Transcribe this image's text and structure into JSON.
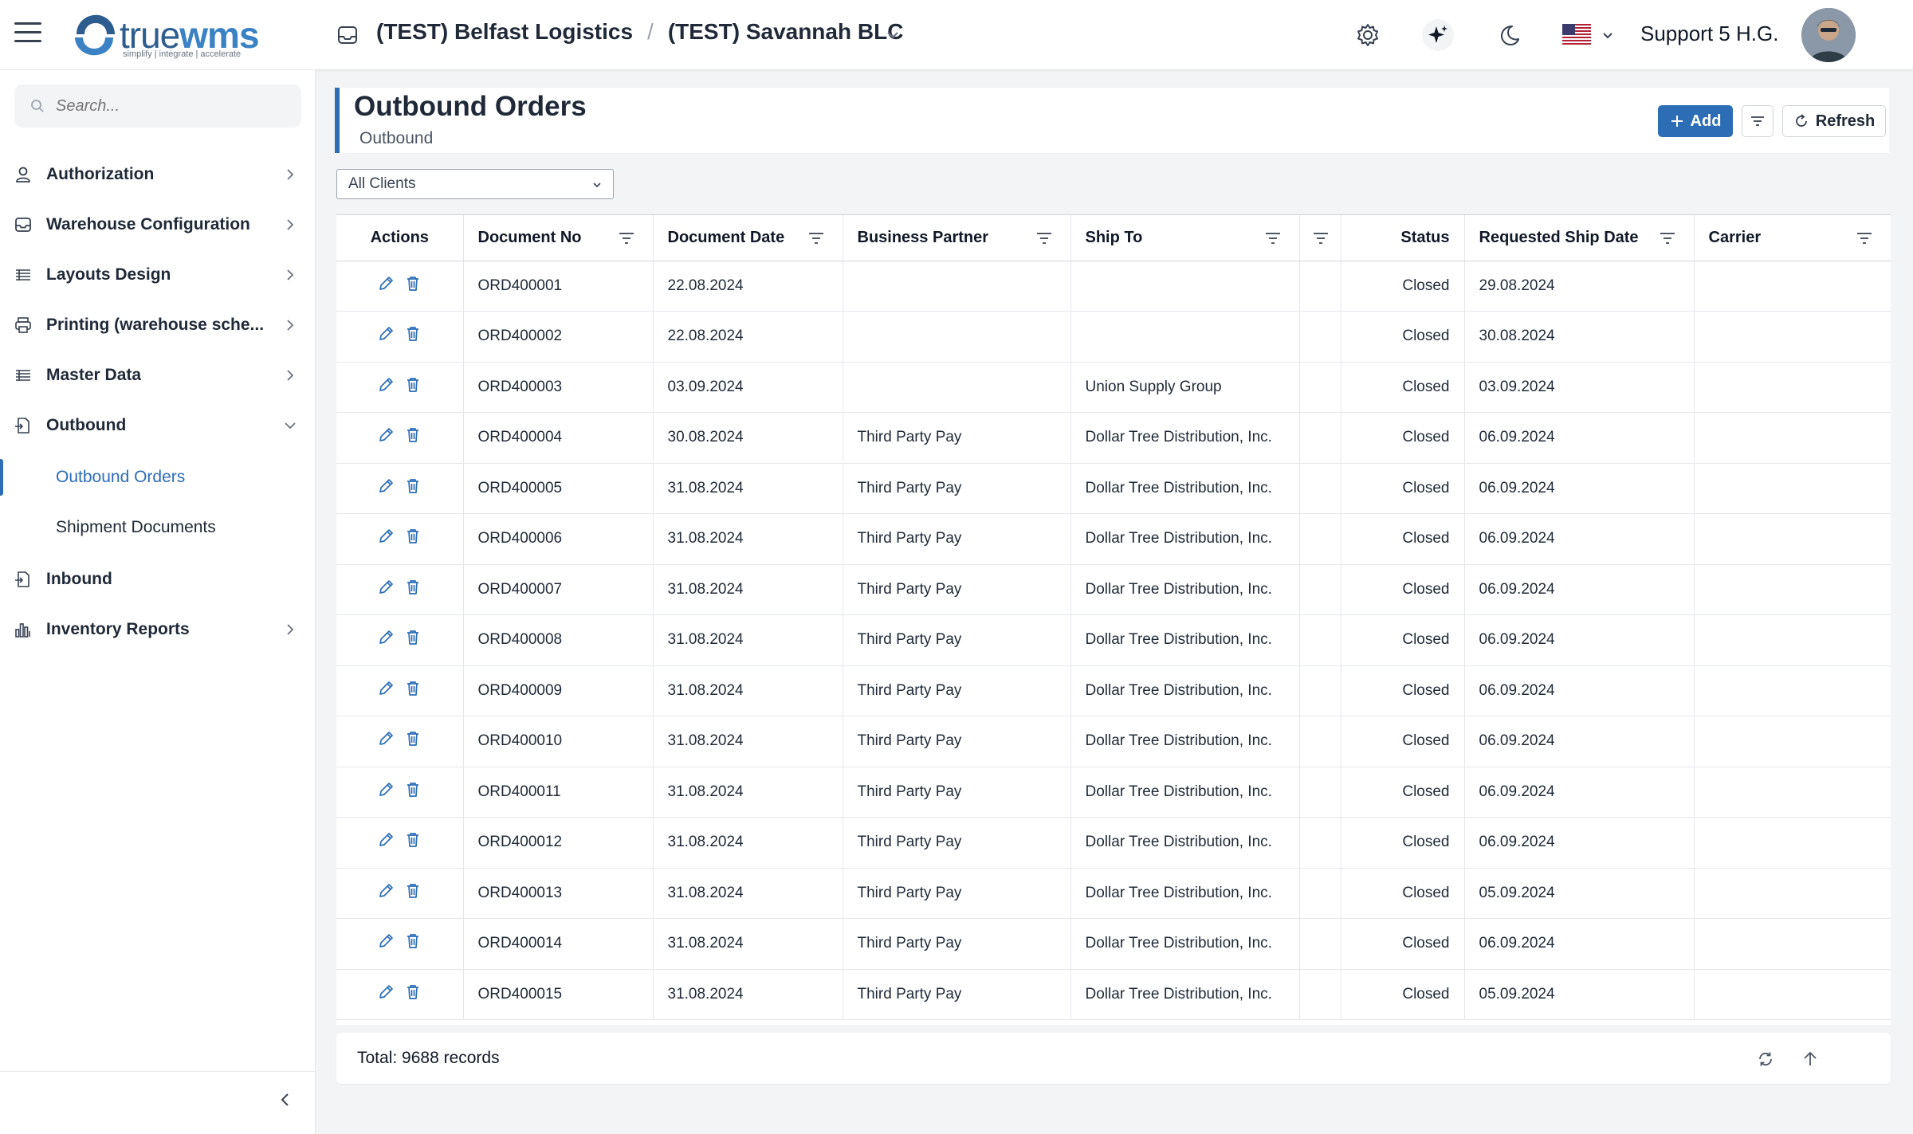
{
  "header": {
    "logo_text_regular": "true",
    "logo_text_bold": "wms",
    "logo_tagline": "simplify | integrate | accelerate",
    "company": "(TEST) Belfast Logistics",
    "separator": "/",
    "warehouse": "(TEST) Savannah BLC",
    "username": "Support 5 H.G.",
    "icons": [
      "menu-icon",
      "warehouse-icon",
      "chevron-down-icon",
      "gear-icon",
      "sparkle-icon",
      "moon-icon",
      "us-flag-icon",
      "user-avatar"
    ]
  },
  "sidebar": {
    "search_placeholder": "Search...",
    "items": [
      {
        "label": "Authorization",
        "icon": "user-icon"
      },
      {
        "label": "Warehouse Configuration",
        "icon": "inbox-icon"
      },
      {
        "label": "Layouts Design",
        "icon": "grid-list-icon"
      },
      {
        "label": "Printing (warehouse sche...",
        "icon": "printer-icon"
      },
      {
        "label": "Master Data",
        "icon": "grid-list-icon"
      },
      {
        "label": "Outbound",
        "icon": "document-out-icon",
        "expanded": true
      },
      {
        "label": "Inbound",
        "icon": "document-in-icon"
      },
      {
        "label": "Inventory Reports",
        "icon": "bar-chart-icon"
      }
    ],
    "subitems": [
      {
        "label": "Outbound Orders",
        "active": true
      },
      {
        "label": "Shipment Documents",
        "active": false
      }
    ]
  },
  "page": {
    "title": "Outbound Orders",
    "subtitle": "Outbound",
    "add_label": "Add",
    "refresh_label": "Refresh",
    "client_filter": "All Clients"
  },
  "table": {
    "columns": [
      "Actions",
      "Document No",
      "Document Date",
      "Business Partner",
      "Ship To",
      "",
      "Status",
      "Requested Ship Date",
      "Carrier"
    ],
    "rows": [
      {
        "doc": "ORD400001",
        "date": "22.08.2024",
        "partner": "",
        "ship_to": "",
        "status": "Closed",
        "req": "29.08.2024",
        "carrier": ""
      },
      {
        "doc": "ORD400002",
        "date": "22.08.2024",
        "partner": "",
        "ship_to": "",
        "status": "Closed",
        "req": "30.08.2024",
        "carrier": ""
      },
      {
        "doc": "ORD400003",
        "date": "03.09.2024",
        "partner": "",
        "ship_to": "Union Supply Group",
        "status": "Closed",
        "req": "03.09.2024",
        "carrier": ""
      },
      {
        "doc": "ORD400004",
        "date": "30.08.2024",
        "partner": "Third Party Pay",
        "ship_to": "Dollar Tree Distribution, Inc.",
        "status": "Closed",
        "req": "06.09.2024",
        "carrier": ""
      },
      {
        "doc": "ORD400005",
        "date": "31.08.2024",
        "partner": "Third Party Pay",
        "ship_to": "Dollar Tree Distribution, Inc.",
        "status": "Closed",
        "req": "06.09.2024",
        "carrier": ""
      },
      {
        "doc": "ORD400006",
        "date": "31.08.2024",
        "partner": "Third Party Pay",
        "ship_to": "Dollar Tree Distribution, Inc.",
        "status": "Closed",
        "req": "06.09.2024",
        "carrier": ""
      },
      {
        "doc": "ORD400007",
        "date": "31.08.2024",
        "partner": "Third Party Pay",
        "ship_to": "Dollar Tree Distribution, Inc.",
        "status": "Closed",
        "req": "06.09.2024",
        "carrier": ""
      },
      {
        "doc": "ORD400008",
        "date": "31.08.2024",
        "partner": "Third Party Pay",
        "ship_to": "Dollar Tree Distribution, Inc.",
        "status": "Closed",
        "req": "06.09.2024",
        "carrier": ""
      },
      {
        "doc": "ORD400009",
        "date": "31.08.2024",
        "partner": "Third Party Pay",
        "ship_to": "Dollar Tree Distribution, Inc.",
        "status": "Closed",
        "req": "06.09.2024",
        "carrier": ""
      },
      {
        "doc": "ORD400010",
        "date": "31.08.2024",
        "partner": "Third Party Pay",
        "ship_to": "Dollar Tree Distribution, Inc.",
        "status": "Closed",
        "req": "06.09.2024",
        "carrier": ""
      },
      {
        "doc": "ORD400011",
        "date": "31.08.2024",
        "partner": "Third Party Pay",
        "ship_to": "Dollar Tree Distribution, Inc.",
        "status": "Closed",
        "req": "06.09.2024",
        "carrier": ""
      },
      {
        "doc": "ORD400012",
        "date": "31.08.2024",
        "partner": "Third Party Pay",
        "ship_to": "Dollar Tree Distribution, Inc.",
        "status": "Closed",
        "req": "06.09.2024",
        "carrier": ""
      },
      {
        "doc": "ORD400013",
        "date": "31.08.2024",
        "partner": "Third Party Pay",
        "ship_to": "Dollar Tree Distribution, Inc.",
        "status": "Closed",
        "req": "05.09.2024",
        "carrier": ""
      },
      {
        "doc": "ORD400014",
        "date": "31.08.2024",
        "partner": "Third Party Pay",
        "ship_to": "Dollar Tree Distribution, Inc.",
        "status": "Closed",
        "req": "06.09.2024",
        "carrier": ""
      },
      {
        "doc": "ORD400015",
        "date": "31.08.2024",
        "partner": "Third Party Pay",
        "ship_to": "Dollar Tree Distribution, Inc.",
        "status": "Closed",
        "req": "05.09.2024",
        "carrier": ""
      }
    ]
  },
  "footer": {
    "total": "Total: 9688 records"
  },
  "colors": {
    "accent": "#2d6db5",
    "brand": "#2d5c8f"
  }
}
